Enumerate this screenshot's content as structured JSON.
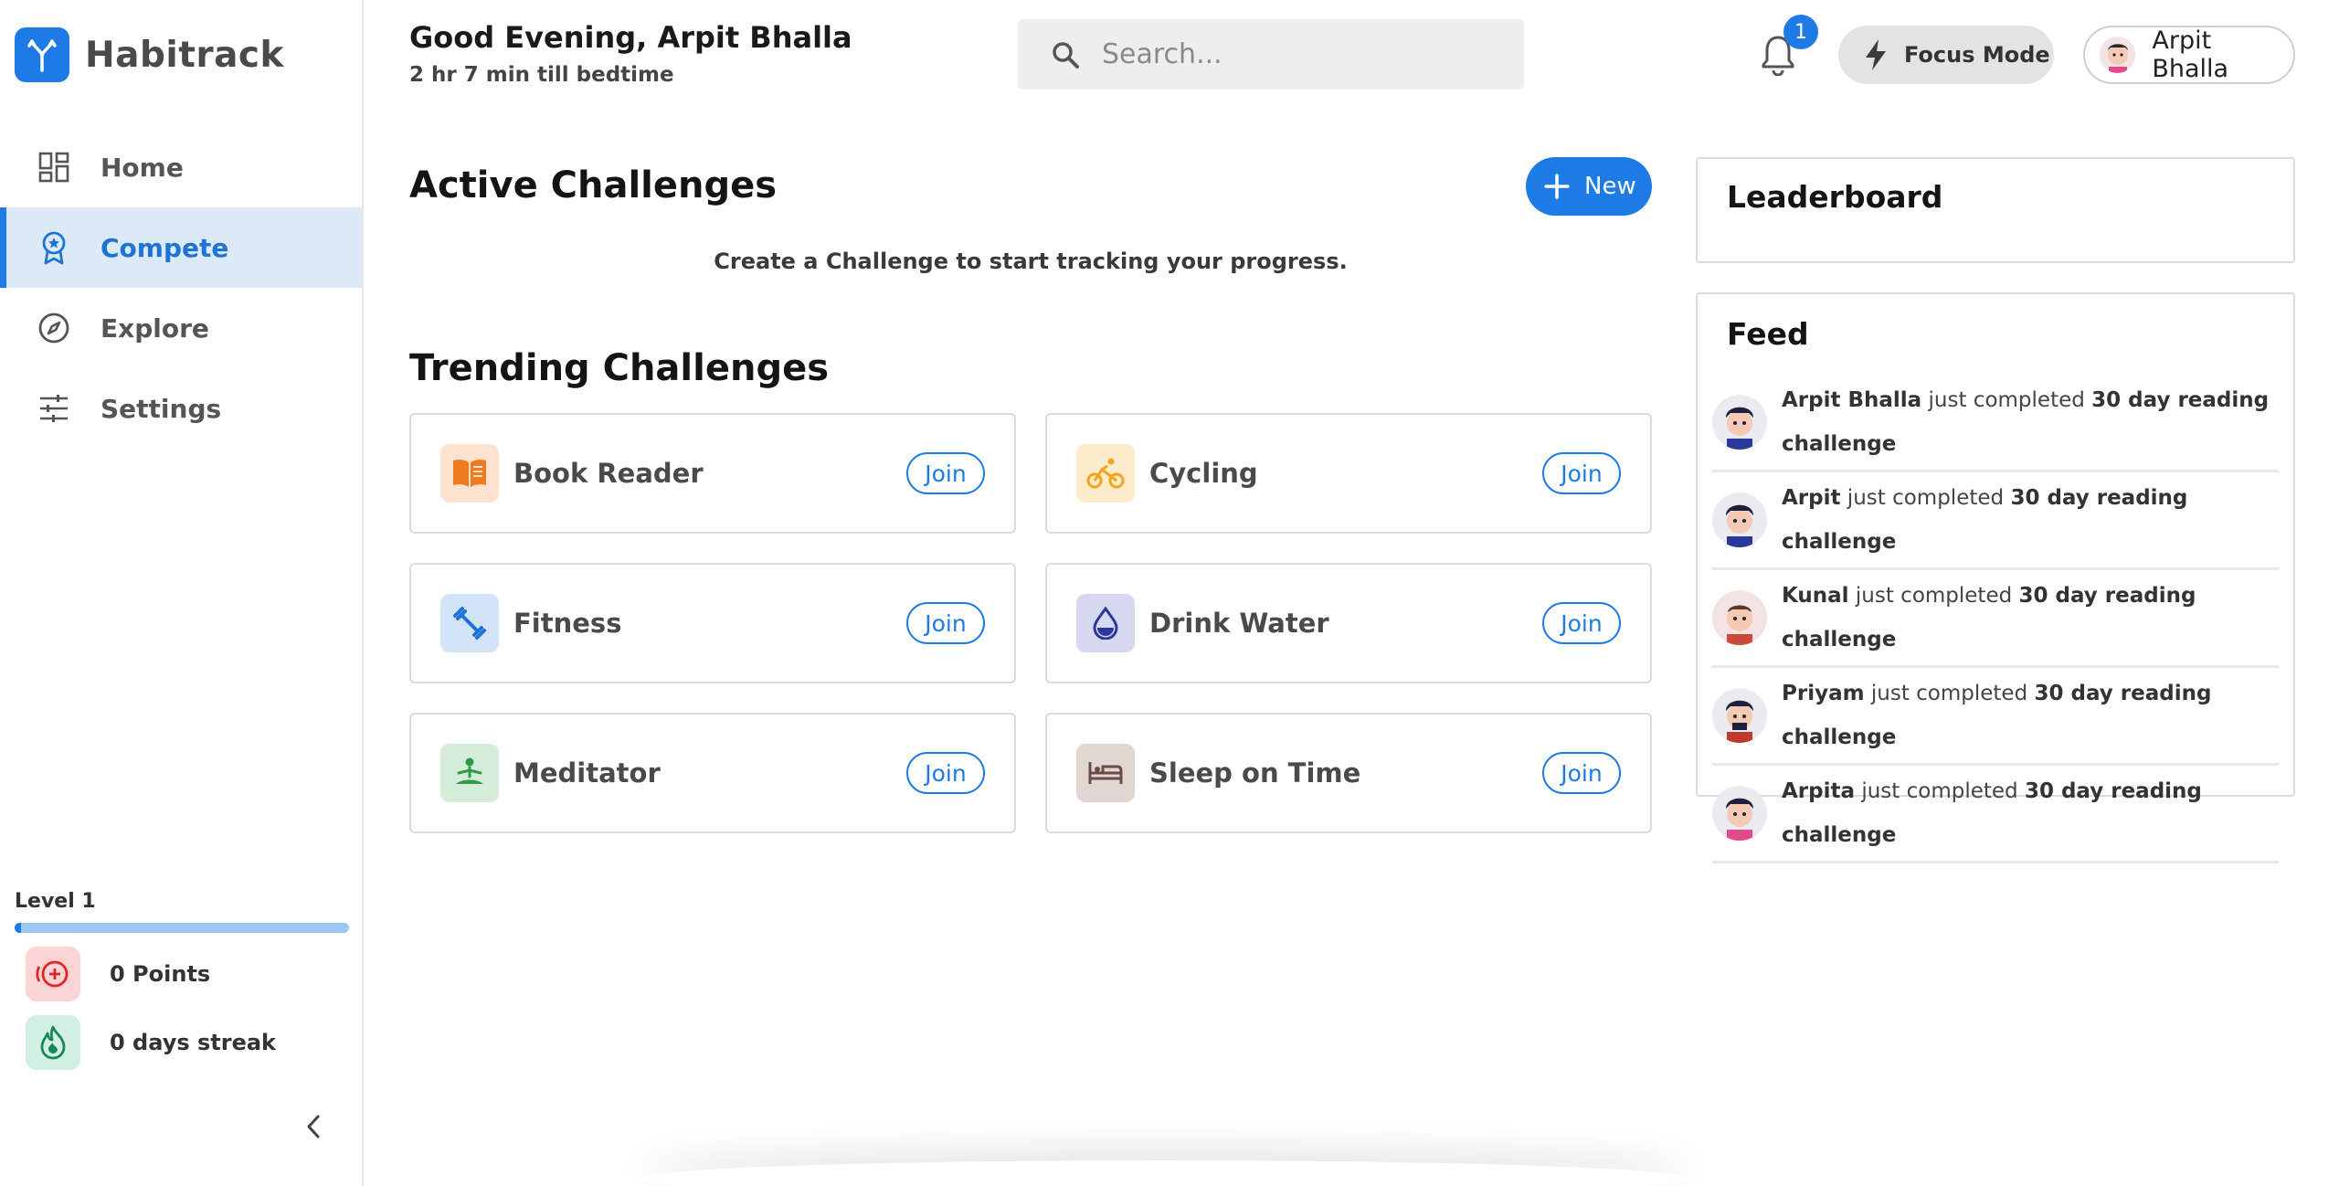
{
  "app": {
    "name": "Habitrack"
  },
  "colors": {
    "accent": "#1e7be6",
    "active_bg": "#dceaf8"
  },
  "sidebar": {
    "items": [
      {
        "label": "Home",
        "icon": "dashboard-icon",
        "active": false
      },
      {
        "label": "Compete",
        "icon": "award-badge-icon",
        "active": true
      },
      {
        "label": "Explore",
        "icon": "compass-icon",
        "active": false
      },
      {
        "label": "Settings",
        "icon": "sliders-icon",
        "active": false
      }
    ],
    "level": {
      "label": "Level 1",
      "progress_percent": 2
    },
    "points_label": "0 Points",
    "streak_label": "0 days streak"
  },
  "header": {
    "greeting": "Good Evening, Arpit Bhalla",
    "subtext": "2 hr 7 min till bedtime",
    "search_placeholder": "Search...",
    "notification_count": "1",
    "focus_label": "Focus Mode",
    "profile_name": "Arpit Bhalla"
  },
  "active": {
    "title": "Active Challenges",
    "new_label": "New",
    "empty_message": "Create a Challenge to start tracking your progress."
  },
  "trending": {
    "title": "Trending Challenges",
    "join_label": "Join",
    "cards": [
      {
        "name": "Book Reader",
        "icon": "book-icon",
        "color": "#f07a1e",
        "bg": "#fde3cf"
      },
      {
        "name": "Cycling",
        "icon": "bicycle-icon",
        "color": "#f5a31a",
        "bg": "#fdeccb"
      },
      {
        "name": "Fitness",
        "icon": "dumbbell-icon",
        "color": "#1e74d4",
        "bg": "#d3e4f8"
      },
      {
        "name": "Drink Water",
        "icon": "water-drop-icon",
        "color": "#2b3a9a",
        "bg": "#d7d9f0"
      },
      {
        "name": "Meditator",
        "icon": "meditation-icon",
        "color": "#2e9a46",
        "bg": "#d5ecd9"
      },
      {
        "name": "Sleep on Time",
        "icon": "bed-icon",
        "color": "#6b4c44",
        "bg": "#e2d6d3"
      }
    ]
  },
  "leaderboard": {
    "title": "Leaderboard"
  },
  "feed": {
    "title": "Feed",
    "items": [
      {
        "user": "Arpit Bhalla",
        "action": " just completed ",
        "challenge": "30 day reading challenge"
      },
      {
        "user": "Arpit",
        "action": " just completed ",
        "challenge": "30 day reading challenge"
      },
      {
        "user": "Kunal",
        "action": " just completed ",
        "challenge": "30 day reading challenge"
      },
      {
        "user": "Priyam",
        "action": " just completed ",
        "challenge": "30 day reading challenge"
      },
      {
        "user": "Arpita",
        "action": " just completed ",
        "challenge": "30 day reading challenge"
      }
    ]
  }
}
